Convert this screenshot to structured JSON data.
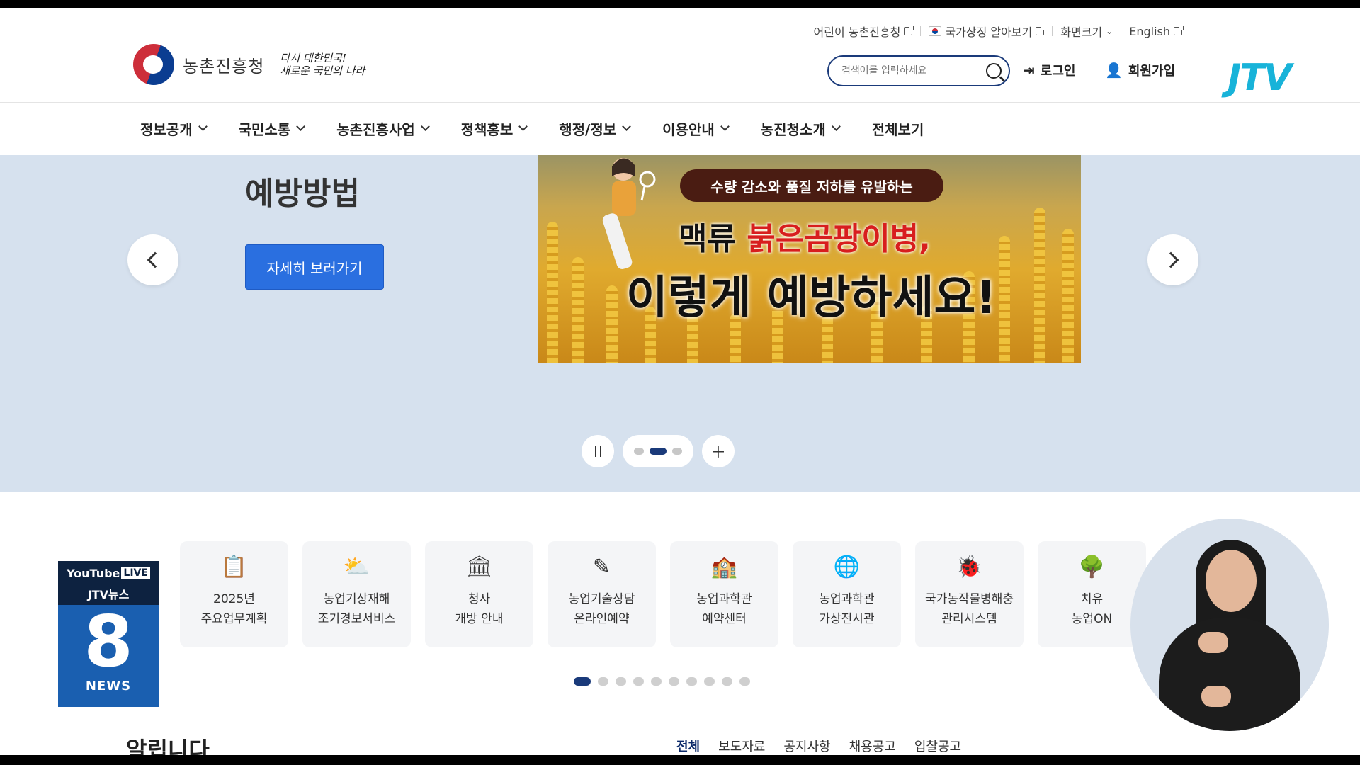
{
  "util": {
    "kids_link": "어린이 농촌진흥청",
    "symbol_link": "국가상징 알아보기",
    "screen_size": "화면크기",
    "english": "English"
  },
  "header": {
    "agency_name": "농촌진흥청",
    "slogan_line1": "다시 대한민국!",
    "slogan_line2": "새로운 국민의 나라",
    "search_placeholder": "검색어를 입력하세요",
    "login": "로그인",
    "join": "회원가입",
    "broadcaster_logo": "JTV"
  },
  "nav": {
    "items": [
      {
        "label": "정보공개"
      },
      {
        "label": "국민소통"
      },
      {
        "label": "농촌진흥사업"
      },
      {
        "label": "정책홍보"
      },
      {
        "label": "행정/정보"
      },
      {
        "label": "이용안내"
      },
      {
        "label": "농진청소개"
      }
    ],
    "view_all": "전체보기"
  },
  "hero": {
    "title": "예방방법",
    "button": "자세히 보러가기",
    "banner_sub": "수량 감소와 품질 저하를 유발하는",
    "banner_line1_pre": "맥류 ",
    "banner_line1_red": "붉은곰팡이병,",
    "banner_line2": "이렇게 예방하세요!",
    "slide_dots": 3,
    "active_slide": 2
  },
  "quick_links": {
    "items": [
      {
        "icon": "clipboard-icon",
        "glyph": "📋",
        "label": "2025년\n주요업무계획"
      },
      {
        "icon": "weather-alert-icon",
        "glyph": "⛅",
        "label": "농업기상재해\n조기경보서비스"
      },
      {
        "icon": "government-building-icon",
        "glyph": "🏛",
        "label": "청사\n개방 안내"
      },
      {
        "icon": "pen-consult-icon",
        "glyph": "✎",
        "label": "농업기술상담\n온라인예약"
      },
      {
        "icon": "science-hall-icon",
        "glyph": "🏫",
        "label": "농업과학관\n예약센터"
      },
      {
        "icon": "globe-icon",
        "glyph": "🌐",
        "label": "농업과학관\n가상전시관"
      },
      {
        "icon": "bug-scan-icon",
        "glyph": "🐞",
        "label": "국가농작물병해충\n관리시스템"
      },
      {
        "icon": "tree-icon",
        "glyph": "🌳",
        "label": "치유\n농업ON"
      }
    ],
    "page_dots": 10,
    "active_page": 1
  },
  "live_badge": {
    "youtube": "YouTube",
    "live": "LIVE",
    "sub": "JTV뉴스",
    "number": "8",
    "news": "NEWS"
  },
  "notice": {
    "title": "알립니다",
    "tabs": [
      "전체",
      "보도자료",
      "공지사항",
      "채용공고",
      "입찰공고"
    ],
    "active_tab": 0
  },
  "colors": {
    "nav_dark": "#1a3a7a",
    "hero_bg": "#d6e1ee",
    "primary_button": "#2a6fe0",
    "jtv": "#18b3d9"
  }
}
